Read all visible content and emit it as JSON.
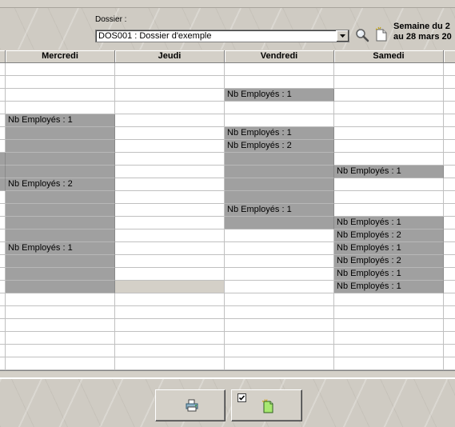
{
  "header": {
    "dossier_label": "Dossier :",
    "dossier_value": "DOS001 : Dossier d'exemple",
    "week_line1": "Semaine du 2",
    "week_line2": "au 28 mars 20"
  },
  "columns": [
    {
      "label": ""
    },
    {
      "label": "Mercredi"
    },
    {
      "label": "Jeudi"
    },
    {
      "label": "Vendredi"
    },
    {
      "label": "Samedi"
    },
    {
      "label": ""
    }
  ],
  "rows": [
    {
      "cells": [
        {
          "text": "",
          "state": "empty"
        },
        {
          "text": "",
          "state": "empty"
        },
        {
          "text": "",
          "state": "empty"
        },
        {
          "text": "",
          "state": "empty"
        },
        {
          "text": "",
          "state": "empty"
        },
        {
          "text": "",
          "state": "empty"
        }
      ]
    },
    {
      "cells": [
        {
          "text": "",
          "state": "empty"
        },
        {
          "text": "",
          "state": "empty"
        },
        {
          "text": "",
          "state": "empty"
        },
        {
          "text": "",
          "state": "empty"
        },
        {
          "text": "",
          "state": "empty"
        },
        {
          "text": "",
          "state": "empty"
        }
      ]
    },
    {
      "cells": [
        {
          "text": "",
          "state": "empty"
        },
        {
          "text": "",
          "state": "empty"
        },
        {
          "text": "",
          "state": "empty"
        },
        {
          "text": "Nb Employés : 1",
          "state": "busy"
        },
        {
          "text": "",
          "state": "empty"
        },
        {
          "text": "",
          "state": "empty"
        }
      ]
    },
    {
      "cells": [
        {
          "text": "",
          "state": "empty"
        },
        {
          "text": "",
          "state": "empty"
        },
        {
          "text": "",
          "state": "empty"
        },
        {
          "text": "",
          "state": "empty"
        },
        {
          "text": "",
          "state": "empty"
        },
        {
          "text": "",
          "state": "empty"
        }
      ]
    },
    {
      "cells": [
        {
          "text": "",
          "state": "empty"
        },
        {
          "text": "Nb Employés : 1",
          "state": "busy"
        },
        {
          "text": "",
          "state": "empty"
        },
        {
          "text": "",
          "state": "empty"
        },
        {
          "text": "",
          "state": "empty"
        },
        {
          "text": "",
          "state": "empty"
        }
      ]
    },
    {
      "cells": [
        {
          "text": "",
          "state": "empty"
        },
        {
          "text": "",
          "state": "busy"
        },
        {
          "text": "",
          "state": "empty"
        },
        {
          "text": "Nb Employés : 1",
          "state": "busy"
        },
        {
          "text": "",
          "state": "empty"
        },
        {
          "text": "",
          "state": "empty"
        }
      ]
    },
    {
      "cells": [
        {
          "text": "",
          "state": "empty"
        },
        {
          "text": "",
          "state": "busy"
        },
        {
          "text": "",
          "state": "empty"
        },
        {
          "text": "Nb Employés : 2",
          "state": "busy"
        },
        {
          "text": "",
          "state": "empty"
        },
        {
          "text": "",
          "state": "empty"
        }
      ]
    },
    {
      "cells": [
        {
          "text": "",
          "state": "busy"
        },
        {
          "text": "",
          "state": "busy"
        },
        {
          "text": "",
          "state": "empty"
        },
        {
          "text": "",
          "state": "busy"
        },
        {
          "text": "",
          "state": "empty"
        },
        {
          "text": "",
          "state": "empty"
        }
      ]
    },
    {
      "cells": [
        {
          "text": "",
          "state": "busy"
        },
        {
          "text": "",
          "state": "busy"
        },
        {
          "text": "",
          "state": "empty"
        },
        {
          "text": "",
          "state": "busy"
        },
        {
          "text": "Nb Employés : 1",
          "state": "busy"
        },
        {
          "text": "",
          "state": "empty"
        }
      ]
    },
    {
      "cells": [
        {
          "text": "",
          "state": "busy"
        },
        {
          "text": "Nb Employés : 2",
          "state": "busy"
        },
        {
          "text": "",
          "state": "empty"
        },
        {
          "text": "",
          "state": "busy"
        },
        {
          "text": "",
          "state": "empty"
        },
        {
          "text": "",
          "state": "empty"
        }
      ]
    },
    {
      "cells": [
        {
          "text": "",
          "state": "empty"
        },
        {
          "text": "",
          "state": "busy"
        },
        {
          "text": "",
          "state": "empty"
        },
        {
          "text": "",
          "state": "busy"
        },
        {
          "text": "",
          "state": "empty"
        },
        {
          "text": "",
          "state": "empty"
        }
      ]
    },
    {
      "cells": [
        {
          "text": "",
          "state": "empty"
        },
        {
          "text": "",
          "state": "busy"
        },
        {
          "text": "",
          "state": "empty"
        },
        {
          "text": "Nb Employés : 1",
          "state": "busy"
        },
        {
          "text": "",
          "state": "empty"
        },
        {
          "text": "",
          "state": "empty"
        }
      ]
    },
    {
      "cells": [
        {
          "text": "",
          "state": "empty"
        },
        {
          "text": "",
          "state": "busy"
        },
        {
          "text": "",
          "state": "empty"
        },
        {
          "text": "",
          "state": "busy"
        },
        {
          "text": "Nb Employés : 1",
          "state": "busy"
        },
        {
          "text": "",
          "state": "empty"
        }
      ]
    },
    {
      "cells": [
        {
          "text": "",
          "state": "empty"
        },
        {
          "text": "",
          "state": "busy"
        },
        {
          "text": "",
          "state": "empty"
        },
        {
          "text": "",
          "state": "empty"
        },
        {
          "text": "Nb Employés : 2",
          "state": "busy"
        },
        {
          "text": "",
          "state": "empty"
        }
      ]
    },
    {
      "cells": [
        {
          "text": "",
          "state": "empty"
        },
        {
          "text": "Nb Employés : 1",
          "state": "busy"
        },
        {
          "text": "",
          "state": "empty"
        },
        {
          "text": "",
          "state": "empty"
        },
        {
          "text": "Nb Employés : 1",
          "state": "busy"
        },
        {
          "text": "",
          "state": "empty"
        }
      ]
    },
    {
      "cells": [
        {
          "text": "",
          "state": "empty"
        },
        {
          "text": "",
          "state": "busy"
        },
        {
          "text": "",
          "state": "empty"
        },
        {
          "text": "",
          "state": "empty"
        },
        {
          "text": "Nb Employés : 2",
          "state": "busy"
        },
        {
          "text": "",
          "state": "empty"
        }
      ]
    },
    {
      "cells": [
        {
          "text": "",
          "state": "empty"
        },
        {
          "text": "",
          "state": "busy"
        },
        {
          "text": "",
          "state": "empty"
        },
        {
          "text": "",
          "state": "empty"
        },
        {
          "text": "Nb Employés : 1",
          "state": "busy"
        },
        {
          "text": "",
          "state": "empty"
        }
      ]
    },
    {
      "cells": [
        {
          "text": "",
          "state": "empty"
        },
        {
          "text": "",
          "state": "busy"
        },
        {
          "text": "",
          "state": "light"
        },
        {
          "text": "",
          "state": "empty"
        },
        {
          "text": "Nb Employés : 1",
          "state": "busy"
        },
        {
          "text": "",
          "state": "empty"
        }
      ]
    },
    {
      "cells": [
        {
          "text": "",
          "state": "empty"
        },
        {
          "text": "",
          "state": "empty"
        },
        {
          "text": "",
          "state": "empty"
        },
        {
          "text": "",
          "state": "empty"
        },
        {
          "text": "",
          "state": "empty"
        },
        {
          "text": "",
          "state": "empty"
        }
      ]
    },
    {
      "cells": [
        {
          "text": "",
          "state": "empty"
        },
        {
          "text": "",
          "state": "empty"
        },
        {
          "text": "",
          "state": "empty"
        },
        {
          "text": "",
          "state": "empty"
        },
        {
          "text": "",
          "state": "empty"
        },
        {
          "text": "",
          "state": "empty"
        }
      ]
    },
    {
      "cells": [
        {
          "text": "",
          "state": "empty"
        },
        {
          "text": "",
          "state": "empty"
        },
        {
          "text": "",
          "state": "empty"
        },
        {
          "text": "",
          "state": "empty"
        },
        {
          "text": "",
          "state": "empty"
        },
        {
          "text": "",
          "state": "empty"
        }
      ]
    },
    {
      "cells": [
        {
          "text": "",
          "state": "empty"
        },
        {
          "text": "",
          "state": "empty"
        },
        {
          "text": "",
          "state": "empty"
        },
        {
          "text": "",
          "state": "empty"
        },
        {
          "text": "",
          "state": "empty"
        },
        {
          "text": "",
          "state": "empty"
        }
      ]
    },
    {
      "cells": [
        {
          "text": "",
          "state": "empty"
        },
        {
          "text": "",
          "state": "empty"
        },
        {
          "text": "",
          "state": "empty"
        },
        {
          "text": "",
          "state": "empty"
        },
        {
          "text": "",
          "state": "empty"
        },
        {
          "text": "",
          "state": "empty"
        }
      ]
    },
    {
      "cells": [
        {
          "text": "",
          "state": "empty"
        },
        {
          "text": "",
          "state": "empty"
        },
        {
          "text": "",
          "state": "empty"
        },
        {
          "text": "",
          "state": "empty"
        },
        {
          "text": "",
          "state": "empty"
        },
        {
          "text": "",
          "state": "empty"
        }
      ]
    }
  ],
  "toolbar": {
    "print_icon": "printer-icon",
    "new_icon": "new-document-icon",
    "checkbox_checked": true
  },
  "icons": {
    "search": "magnifier-icon",
    "new_dossier": "new-page-icon",
    "dropdown": "chevron-down-icon"
  },
  "colors": {
    "busy_cell": "#a0a0a0",
    "face": "#d4d0c8"
  }
}
